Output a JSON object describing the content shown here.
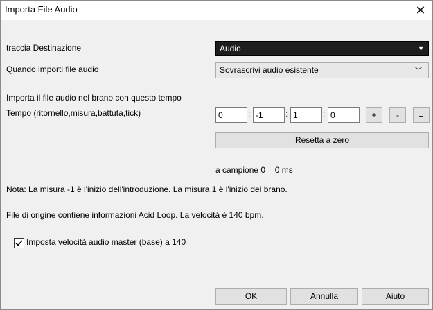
{
  "window": {
    "title": "Importa File Audio",
    "close_glyph": "✕"
  },
  "destination": {
    "label": "traccia Destinazione",
    "value": "Audio"
  },
  "import_mode": {
    "label": "Quando importi file audio",
    "value": "Sovrascrivi audio esistente"
  },
  "tempo": {
    "intro_text": "Importa il file audio nel brano con questo tempo",
    "label": "Tempo (ritornello,misura,battuta,tick)",
    "fields": [
      "0",
      "-1",
      "1",
      "0"
    ],
    "plus_label": "+",
    "minus_label": "-",
    "equals_label": "=",
    "reset_label": "Resetta a zero",
    "sample_text": "a campione 0 = 0 ms"
  },
  "note_text": "Nota: La misura -1 è l'inizio dell'introduzione. La misura 1 è l'inizio del brano.",
  "acid_text": "File di origine contiene informazioni Acid Loop. La velocità è 140 bpm.",
  "master_speed": {
    "label": "Imposta velocità audio master (base) a 140",
    "checked": true
  },
  "buttons": {
    "ok": "OK",
    "cancel": "Annulla",
    "help": "Aiuto"
  }
}
